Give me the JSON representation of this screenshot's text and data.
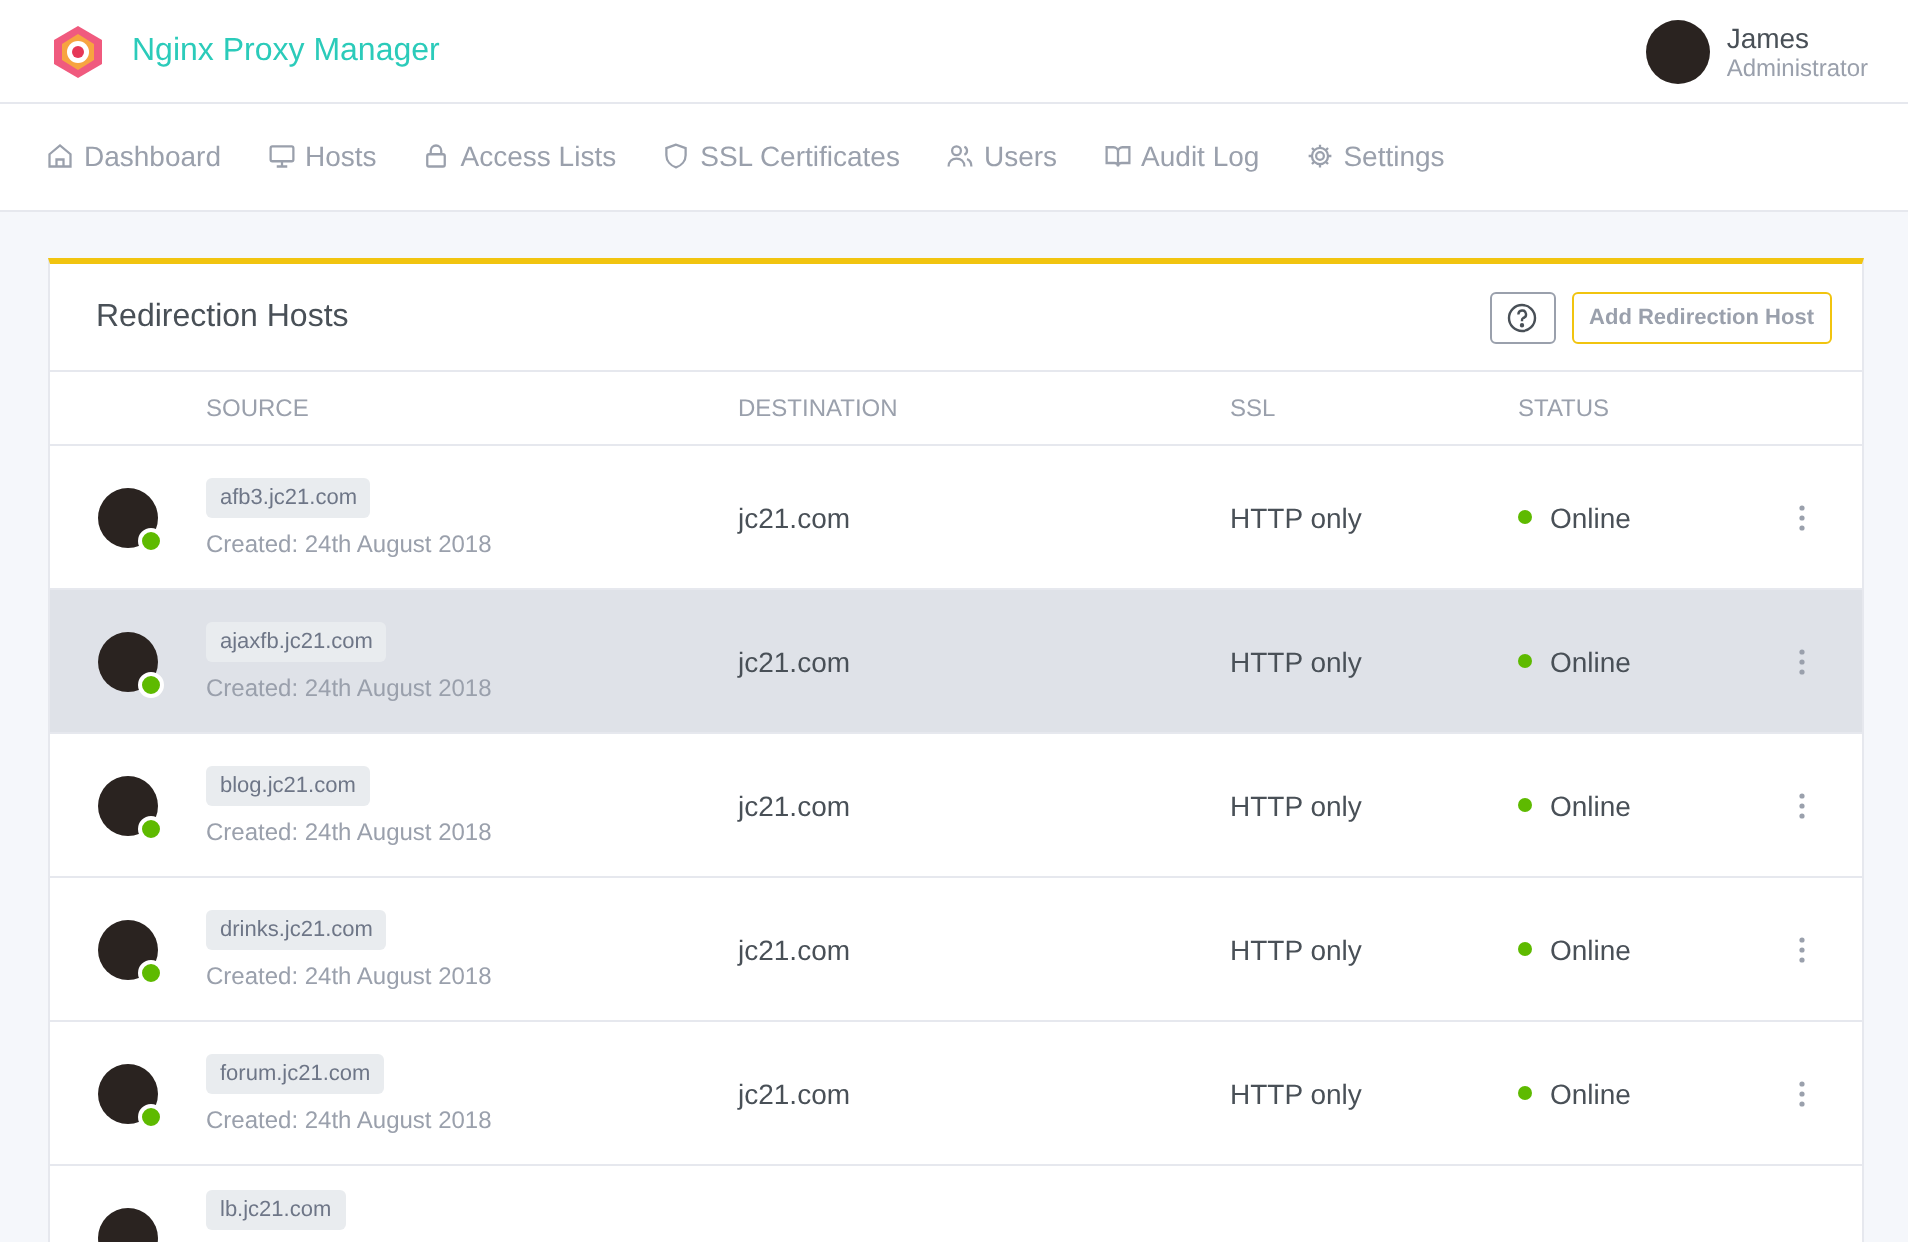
{
  "app": {
    "title": "Nginx Proxy Manager"
  },
  "user": {
    "name": "James",
    "role": "Administrator"
  },
  "nav": [
    {
      "label": "Dashboard",
      "selected": false
    },
    {
      "label": "Hosts",
      "selected": false
    },
    {
      "label": "Access Lists",
      "selected": false
    },
    {
      "label": "SSL Certificates",
      "selected": false
    },
    {
      "label": "Users",
      "selected": false
    },
    {
      "label": "Audit Log",
      "selected": false
    },
    {
      "label": "Settings",
      "selected": false
    }
  ],
  "card": {
    "title": "Redirection Hosts",
    "add_button": "Add Redirection Host"
  },
  "table": {
    "columns": [
      "SOURCE",
      "DESTINATION",
      "SSL",
      "STATUS"
    ],
    "rows": [
      {
        "source": "afb3.jc21.com",
        "created": "Created: 24th August 2018",
        "destination": "jc21.com",
        "ssl": "HTTP only",
        "status": "Online",
        "online": true,
        "highlighted": false
      },
      {
        "source": "ajaxfb.jc21.com",
        "created": "Created: 24th August 2018",
        "destination": "jc21.com",
        "ssl": "HTTP only",
        "status": "Online",
        "online": true,
        "highlighted": true
      },
      {
        "source": "blog.jc21.com",
        "created": "Created: 24th August 2018",
        "destination": "jc21.com",
        "ssl": "HTTP only",
        "status": "Online",
        "online": true,
        "highlighted": false
      },
      {
        "source": "drinks.jc21.com",
        "created": "Created: 24th August 2018",
        "destination": "jc21.com",
        "ssl": "HTTP only",
        "status": "Online",
        "online": true,
        "highlighted": false
      },
      {
        "source": "forum.jc21.com",
        "created": "Created: 24th August 2018",
        "destination": "jc21.com",
        "ssl": "HTTP only",
        "status": "Online",
        "online": true,
        "highlighted": false
      },
      {
        "source": "lb.jc21.com"
      }
    ]
  }
}
